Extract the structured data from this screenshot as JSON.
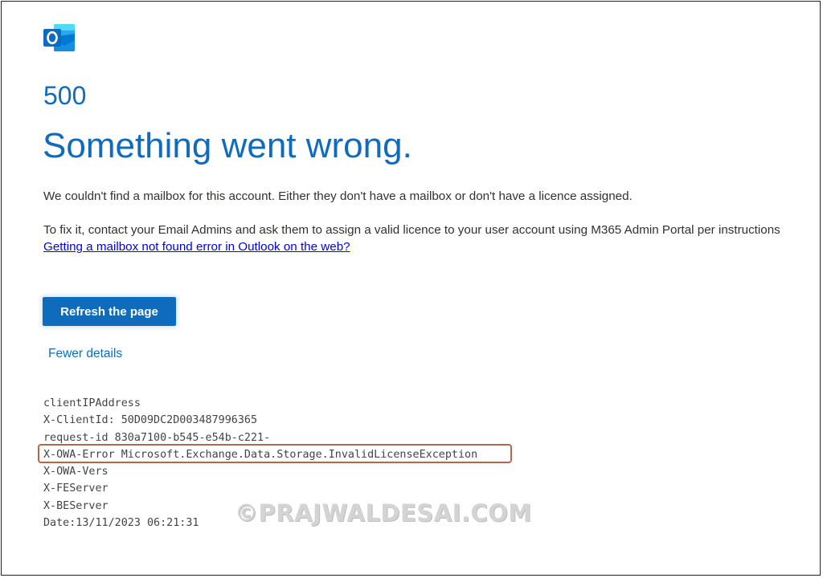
{
  "app": {
    "logo_icon": "outlook-logo-icon",
    "brand_color": "#0f6cbd",
    "link_color": "#0000ee"
  },
  "error": {
    "code": "500",
    "title": "Something went wrong.",
    "message_1": "We couldn't find a mailbox for this account. Either they don't have a mailbox or don't have a licence assigned.",
    "message_2": "To fix it, contact your Email Admins and ask them to assign a valid licence to your user account using M365 Admin Portal per instructions",
    "help_link": "Getting a mailbox not found error in Outlook on the web?"
  },
  "actions": {
    "refresh_label": "Refresh the page",
    "fewer_details_label": "Fewer details"
  },
  "details": [
    "clientIPAddress",
    "X-ClientId: 50D09DC2D003487996365",
    "request-id 830a7100-b545-e54b-c221-",
    "X-OWA-Error Microsoft.Exchange.Data.Storage.InvalidLicenseException",
    "X-OWA-Vers",
    "X-FEServer",
    "X-BEServer",
    "Date:13/11/2023 06:21:31"
  ],
  "highlight_color": "#b8664a",
  "watermark": "©PRAJWALDESAI.COM"
}
